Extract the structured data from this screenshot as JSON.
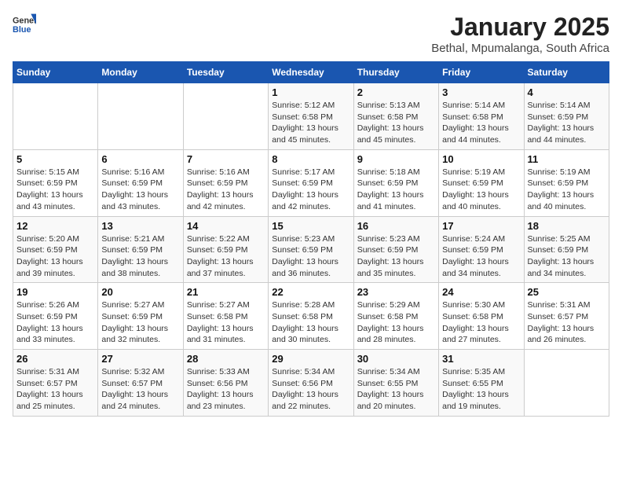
{
  "header": {
    "logo_general": "General",
    "logo_blue": "Blue",
    "month": "January 2025",
    "location": "Bethal, Mpumalanga, South Africa"
  },
  "weekdays": [
    "Sunday",
    "Monday",
    "Tuesday",
    "Wednesday",
    "Thursday",
    "Friday",
    "Saturday"
  ],
  "weeks": [
    [
      {
        "day": "",
        "sunrise": "",
        "sunset": "",
        "daylight": ""
      },
      {
        "day": "",
        "sunrise": "",
        "sunset": "",
        "daylight": ""
      },
      {
        "day": "",
        "sunrise": "",
        "sunset": "",
        "daylight": ""
      },
      {
        "day": "1",
        "sunrise": "Sunrise: 5:12 AM",
        "sunset": "Sunset: 6:58 PM",
        "daylight": "Daylight: 13 hours and 45 minutes."
      },
      {
        "day": "2",
        "sunrise": "Sunrise: 5:13 AM",
        "sunset": "Sunset: 6:58 PM",
        "daylight": "Daylight: 13 hours and 45 minutes."
      },
      {
        "day": "3",
        "sunrise": "Sunrise: 5:14 AM",
        "sunset": "Sunset: 6:58 PM",
        "daylight": "Daylight: 13 hours and 44 minutes."
      },
      {
        "day": "4",
        "sunrise": "Sunrise: 5:14 AM",
        "sunset": "Sunset: 6:59 PM",
        "daylight": "Daylight: 13 hours and 44 minutes."
      }
    ],
    [
      {
        "day": "5",
        "sunrise": "Sunrise: 5:15 AM",
        "sunset": "Sunset: 6:59 PM",
        "daylight": "Daylight: 13 hours and 43 minutes."
      },
      {
        "day": "6",
        "sunrise": "Sunrise: 5:16 AM",
        "sunset": "Sunset: 6:59 PM",
        "daylight": "Daylight: 13 hours and 43 minutes."
      },
      {
        "day": "7",
        "sunrise": "Sunrise: 5:16 AM",
        "sunset": "Sunset: 6:59 PM",
        "daylight": "Daylight: 13 hours and 42 minutes."
      },
      {
        "day": "8",
        "sunrise": "Sunrise: 5:17 AM",
        "sunset": "Sunset: 6:59 PM",
        "daylight": "Daylight: 13 hours and 42 minutes."
      },
      {
        "day": "9",
        "sunrise": "Sunrise: 5:18 AM",
        "sunset": "Sunset: 6:59 PM",
        "daylight": "Daylight: 13 hours and 41 minutes."
      },
      {
        "day": "10",
        "sunrise": "Sunrise: 5:19 AM",
        "sunset": "Sunset: 6:59 PM",
        "daylight": "Daylight: 13 hours and 40 minutes."
      },
      {
        "day": "11",
        "sunrise": "Sunrise: 5:19 AM",
        "sunset": "Sunset: 6:59 PM",
        "daylight": "Daylight: 13 hours and 40 minutes."
      }
    ],
    [
      {
        "day": "12",
        "sunrise": "Sunrise: 5:20 AM",
        "sunset": "Sunset: 6:59 PM",
        "daylight": "Daylight: 13 hours and 39 minutes."
      },
      {
        "day": "13",
        "sunrise": "Sunrise: 5:21 AM",
        "sunset": "Sunset: 6:59 PM",
        "daylight": "Daylight: 13 hours and 38 minutes."
      },
      {
        "day": "14",
        "sunrise": "Sunrise: 5:22 AM",
        "sunset": "Sunset: 6:59 PM",
        "daylight": "Daylight: 13 hours and 37 minutes."
      },
      {
        "day": "15",
        "sunrise": "Sunrise: 5:23 AM",
        "sunset": "Sunset: 6:59 PM",
        "daylight": "Daylight: 13 hours and 36 minutes."
      },
      {
        "day": "16",
        "sunrise": "Sunrise: 5:23 AM",
        "sunset": "Sunset: 6:59 PM",
        "daylight": "Daylight: 13 hours and 35 minutes."
      },
      {
        "day": "17",
        "sunrise": "Sunrise: 5:24 AM",
        "sunset": "Sunset: 6:59 PM",
        "daylight": "Daylight: 13 hours and 34 minutes."
      },
      {
        "day": "18",
        "sunrise": "Sunrise: 5:25 AM",
        "sunset": "Sunset: 6:59 PM",
        "daylight": "Daylight: 13 hours and 34 minutes."
      }
    ],
    [
      {
        "day": "19",
        "sunrise": "Sunrise: 5:26 AM",
        "sunset": "Sunset: 6:59 PM",
        "daylight": "Daylight: 13 hours and 33 minutes."
      },
      {
        "day": "20",
        "sunrise": "Sunrise: 5:27 AM",
        "sunset": "Sunset: 6:59 PM",
        "daylight": "Daylight: 13 hours and 32 minutes."
      },
      {
        "day": "21",
        "sunrise": "Sunrise: 5:27 AM",
        "sunset": "Sunset: 6:58 PM",
        "daylight": "Daylight: 13 hours and 31 minutes."
      },
      {
        "day": "22",
        "sunrise": "Sunrise: 5:28 AM",
        "sunset": "Sunset: 6:58 PM",
        "daylight": "Daylight: 13 hours and 30 minutes."
      },
      {
        "day": "23",
        "sunrise": "Sunrise: 5:29 AM",
        "sunset": "Sunset: 6:58 PM",
        "daylight": "Daylight: 13 hours and 28 minutes."
      },
      {
        "day": "24",
        "sunrise": "Sunrise: 5:30 AM",
        "sunset": "Sunset: 6:58 PM",
        "daylight": "Daylight: 13 hours and 27 minutes."
      },
      {
        "day": "25",
        "sunrise": "Sunrise: 5:31 AM",
        "sunset": "Sunset: 6:57 PM",
        "daylight": "Daylight: 13 hours and 26 minutes."
      }
    ],
    [
      {
        "day": "26",
        "sunrise": "Sunrise: 5:31 AM",
        "sunset": "Sunset: 6:57 PM",
        "daylight": "Daylight: 13 hours and 25 minutes."
      },
      {
        "day": "27",
        "sunrise": "Sunrise: 5:32 AM",
        "sunset": "Sunset: 6:57 PM",
        "daylight": "Daylight: 13 hours and 24 minutes."
      },
      {
        "day": "28",
        "sunrise": "Sunrise: 5:33 AM",
        "sunset": "Sunset: 6:56 PM",
        "daylight": "Daylight: 13 hours and 23 minutes."
      },
      {
        "day": "29",
        "sunrise": "Sunrise: 5:34 AM",
        "sunset": "Sunset: 6:56 PM",
        "daylight": "Daylight: 13 hours and 22 minutes."
      },
      {
        "day": "30",
        "sunrise": "Sunrise: 5:34 AM",
        "sunset": "Sunset: 6:55 PM",
        "daylight": "Daylight: 13 hours and 20 minutes."
      },
      {
        "day": "31",
        "sunrise": "Sunrise: 5:35 AM",
        "sunset": "Sunset: 6:55 PM",
        "daylight": "Daylight: 13 hours and 19 minutes."
      },
      {
        "day": "",
        "sunrise": "",
        "sunset": "",
        "daylight": ""
      }
    ]
  ]
}
